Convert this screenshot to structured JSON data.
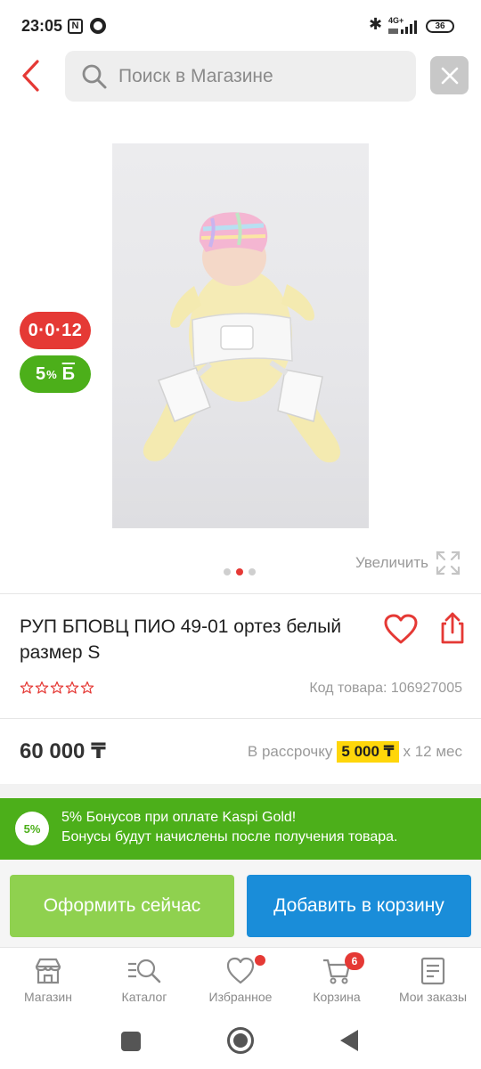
{
  "status_bar": {
    "time": "23:05",
    "nfc_glyph": "N",
    "network": "4G+",
    "battery": "36"
  },
  "header": {
    "search_placeholder": "Поиск в Магазине"
  },
  "product": {
    "badge_installment": "0·0·12",
    "badge_bonus_value": "5",
    "badge_bonus_percent": "%",
    "badge_bonus_currency": "Б",
    "zoom_label": "Увеличить",
    "gallery_dots_total": 3,
    "gallery_dots_active_index": 2,
    "title": "РУП БПОВЦ ПИО 49-01 ортез белый размер S",
    "rating_stars": 0,
    "rating_max": 5,
    "code": "Код товара: 106927005",
    "price": "60 000 ₸",
    "installment_prefix": "В рассрочку",
    "installment_amount": "5 000 ₸",
    "installment_suffix": "x 12 мес"
  },
  "bonus_banner": {
    "circle": "5%",
    "line1": "5% Бонусов при оплате Kaspi Gold!",
    "line2": "Бонусы будут начислены после получения товара."
  },
  "actions": {
    "buy_now": "Оформить сейчас",
    "add_to_cart": "Добавить в корзину"
  },
  "bottom_nav": {
    "items": [
      {
        "label": "Магазин",
        "icon": "shop-icon"
      },
      {
        "label": "Каталог",
        "icon": "catalog-icon"
      },
      {
        "label": "Избранное",
        "icon": "heart-icon"
      },
      {
        "label": "Корзина",
        "icon": "cart-icon",
        "badge": "6"
      },
      {
        "label": "Мои заказы",
        "icon": "orders-icon"
      }
    ]
  },
  "colors": {
    "accent_red": "#e53935",
    "bonus_green": "#4caf1a",
    "buy_green": "#8fd14f",
    "cart_blue": "#1a8dd9",
    "installment_yellow": "#ffd60a"
  }
}
